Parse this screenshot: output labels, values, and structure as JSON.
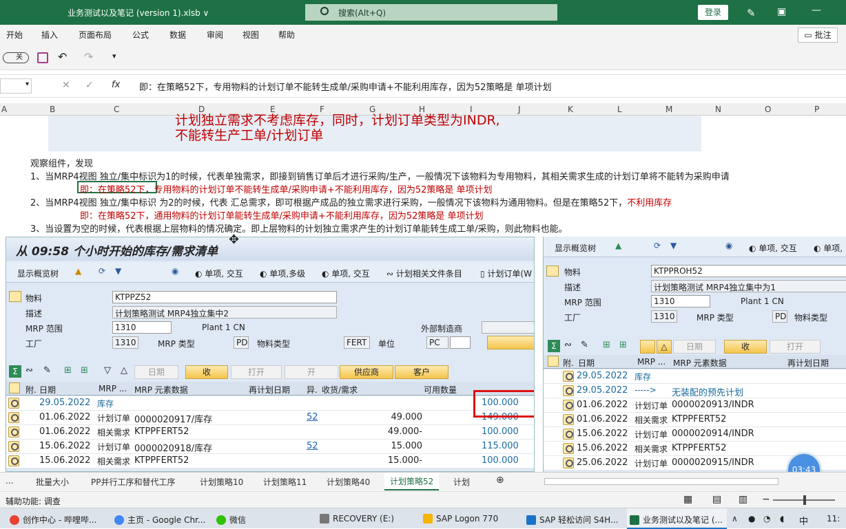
{
  "titlebar": {
    "doc_title": "业务测试以及笔记 (version 1).xlsb ∨",
    "search": "搜索(Alt+Q)",
    "login": "登录"
  },
  "menu": [
    "开始",
    "插入",
    "页面布局",
    "公式",
    "数据",
    "审阅",
    "视图",
    "帮助"
  ],
  "comment_btn": "批注",
  "qat": {
    "toggle": "关"
  },
  "formula": {
    "fx": "fx",
    "content": "即：在策略52下，专用物料的计划订单不能转生成单/采购申请+不能利用库存，因为52策略是 单项计划"
  },
  "columns": [
    "A",
    "B",
    "C",
    "D",
    "E",
    "F",
    "G",
    "H",
    "I",
    "J",
    "K",
    "L",
    "M",
    "N",
    "O",
    "P"
  ],
  "sheet": {
    "top_red1": "计划独立需求不考虑库存，同时，计划订单类型为INDR,",
    "top_red2": "不能转生产工单/计划订单",
    "l1": "观察组件，发现",
    "l2": "1、当MRP4视图 独立/集中标识为1的时候，代表单独需求，即接到销售订单后才进行采购/生产，一般情况下该物料为专用物料，其相关需求生成的计划订单将不能转为采购申请",
    "l3": "即：在策略52下，专用物料的计划订单不能转生成单/采购申请+不能利用库存，因为52策略是 单项计划",
    "l4a": "2、当MRP4视图 独立/集中标识 为2的时候，代表 汇总需求，即可根据产成品的独立需求进行采购，一般情况下该物料为通用物料。但是在策略52下，",
    "l4b": "不利用库存",
    "l5": "即：在策略52下，通用物料的计划订单能转生成单/采购申请+不能利用库存，因为52策略是 单项计划",
    "l6": "3、当设置为空的时候，代表根据上层物料的情况确定。即上层物料的计划独立需求产生的计划订单能转生成工单/采购，则此物料也能。"
  },
  "sapL": {
    "title": "从 09:58 个小时开始的库存/需求清单",
    "toolbar": [
      "显示概览树",
      "单项, 交互",
      "单项,多级",
      "单项, 交互",
      "计划相关文件条目",
      "计划订单(W"
    ],
    "material_label": "物料",
    "material": "KTPPZ52",
    "desc_label": "描述",
    "desc": "计划策略测试 MRP4独立集中2",
    "mrp_label": "MRP 范围",
    "mrp": "1310",
    "plant": "Plant 1 CN",
    "ext_label": "外部制造商",
    "plant_label": "工厂",
    "plant_val": "1310",
    "mrptype_label": "MRP 类型",
    "mrptype": "PD",
    "mattype_label": "物料类型",
    "mattype": "FERT",
    "unit_label": "单位",
    "unit": "PC",
    "btns": {
      "date": "日期",
      "recv": "收",
      "open": "打开",
      "open2": "开",
      "vendor": "供应商",
      "cust": "客户"
    },
    "headers": [
      "附.",
      "日期",
      "MRP ...",
      "MRP 元素数据",
      "再计划日期",
      "异.",
      "收货/需求",
      "可用数量"
    ],
    "rows": [
      {
        "date": "29.05.2022",
        "type": "库存",
        "data": "",
        "exc": "",
        "qty": "",
        "avail": "100.000"
      },
      {
        "date": "01.06.2022",
        "type": "计划订单",
        "data": "0000020917/库存",
        "exc": "52",
        "qty": "49.000",
        "avail": "149.000"
      },
      {
        "date": "01.06.2022",
        "type": "相关需求",
        "data": "KTPPFERT52",
        "exc": "",
        "qty": "49.000-",
        "avail": "100.000"
      },
      {
        "date": "15.06.2022",
        "type": "计划订单",
        "data": "0000020918/库存",
        "exc": "52",
        "qty": "15.000",
        "avail": "115.000"
      },
      {
        "date": "15.06.2022",
        "type": "相关需求",
        "data": "KTPPFERT52",
        "exc": "",
        "qty": "15.000-",
        "avail": "100.000"
      }
    ]
  },
  "sapR": {
    "toolbar": [
      "显示概览树",
      "单项, 交互",
      "单项,"
    ],
    "material_label": "物料",
    "material": "KTPPROH52",
    "desc_label": "描述",
    "desc": "计划策略测试 MRP4独立集中为1",
    "mrp_label": "MRP 范围",
    "mrp": "1310",
    "plant": "Plant 1 CN",
    "plant_label": "工厂",
    "plant_val": "1310",
    "mrptype_label": "MRP 类型",
    "mrptype": "PD",
    "mattype_label": "物料类型",
    "btns": {
      "date": "日期",
      "recv": "收",
      "open": "打开"
    },
    "headers": [
      "附.",
      "日期",
      "MRP ...",
      "MRP 元素数据",
      "再计划日期"
    ],
    "rows": [
      {
        "date": "29.05.2022",
        "type": "库存",
        "data": ""
      },
      {
        "date": "29.05.2022",
        "type": "----->",
        "data": "无装配的预先计划"
      },
      {
        "date": "01.06.2022",
        "type": "计划订单",
        "data": "0000020913/INDR"
      },
      {
        "date": "01.06.2022",
        "type": "相关需求",
        "data": "KTPPFERT52"
      },
      {
        "date": "15.06.2022",
        "type": "计划订单",
        "data": "0000020914/INDR"
      },
      {
        "date": "15.06.2022",
        "type": "相关需求",
        "data": "KTPPFERT52"
      },
      {
        "date": "25.06.2022",
        "type": "计划订单",
        "data": "0000020915/INDR"
      }
    ]
  },
  "tabs": [
    "...",
    "批量大小",
    "PP并行工序和替代工序",
    "计划策略10",
    "计划策略11",
    "计划策略40",
    "计划策略52",
    "计划"
  ],
  "status": "辅助功能: 调查",
  "timer": "03:43",
  "taskbar": [
    "创作中心 - 哔哩哔...",
    "主页 - Google Chr...",
    "微信",
    "RECOVERY (E:)",
    "SAP Logon 770",
    "SAP 轻松访问 S4H...",
    "业务测试以及笔记 (..."
  ],
  "tray": {
    "ime": "中",
    "clock": "11:"
  }
}
